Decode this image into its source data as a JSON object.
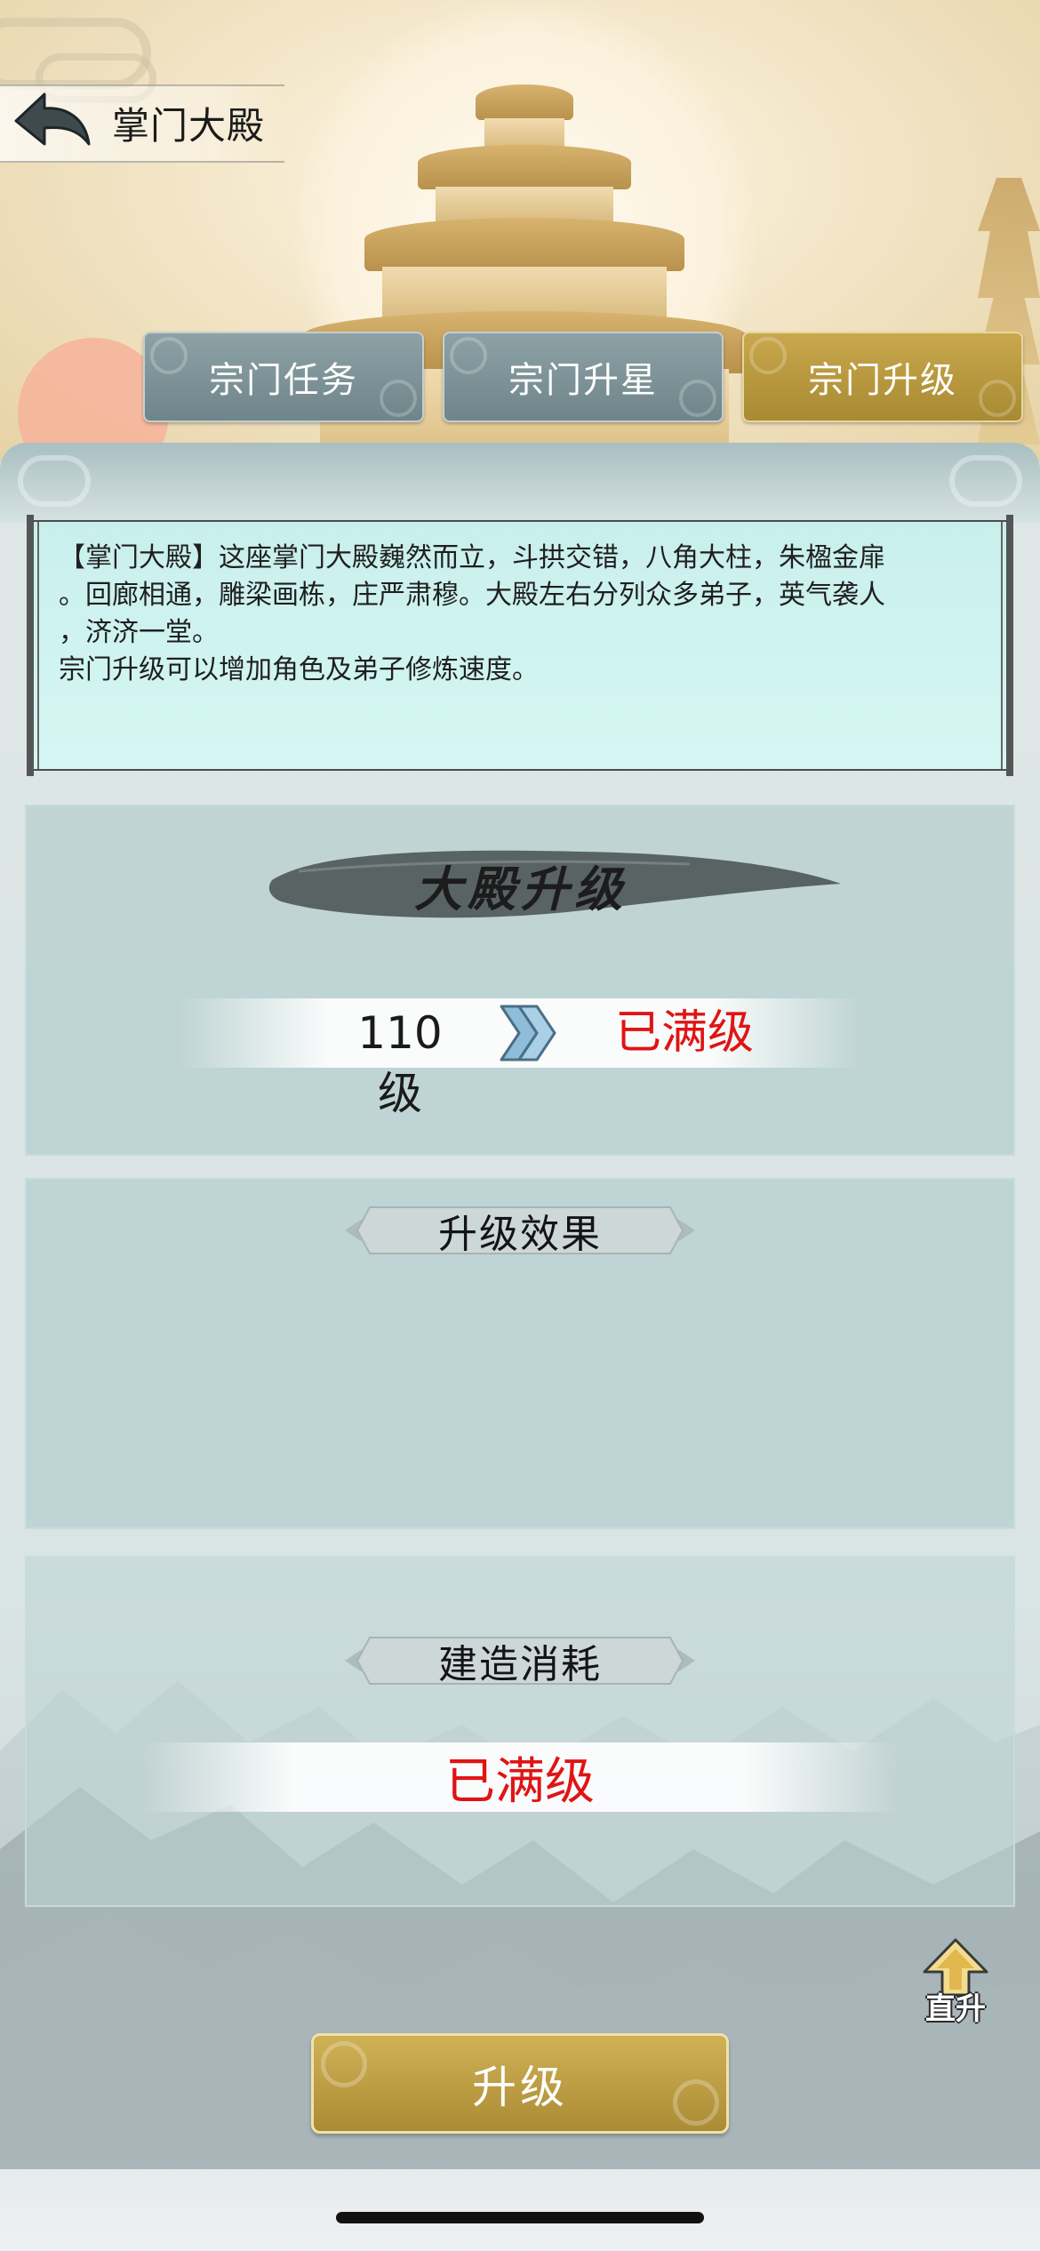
{
  "header": {
    "title": "掌门大殿",
    "back_icon": "back-arrow-icon"
  },
  "tabs": [
    {
      "label": "宗门任务",
      "active": false
    },
    {
      "label": "宗门升星",
      "active": false
    },
    {
      "label": "宗门升级",
      "active": true
    }
  ],
  "description": {
    "lines": [
      "【掌门大殿】这座掌门大殿巍然而立，斗拱交错，八角大柱，朱楹金扉",
      "。回廊相通，雕梁画栋，庄严肃穆。大殿左右分列众多弟子，英气袭人",
      "，济济一堂。",
      "宗门升级可以增加角色及弟子修炼速度。"
    ]
  },
  "upgrade_section": {
    "title": "大殿升级",
    "current_level": "110级",
    "next_level": "已满级"
  },
  "effect_section": {
    "title": "升级效果"
  },
  "cost_section": {
    "title": "建造消耗",
    "value": "已满级"
  },
  "shortcut": {
    "label": "直升",
    "icon": "up-arrow-icon"
  },
  "upgrade_button": {
    "label": "升级"
  },
  "colors": {
    "accent_gold": "#b8973f",
    "tab_inactive": "#7d9498",
    "max_level_red": "#e01414",
    "scroll_bg": "#cff3f0"
  }
}
